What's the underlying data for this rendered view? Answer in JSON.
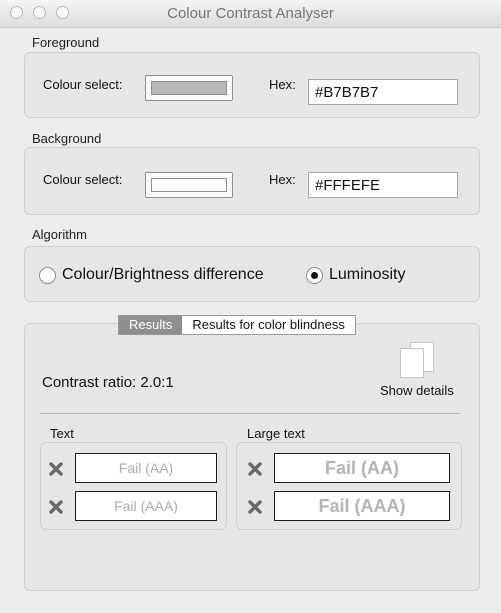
{
  "window": {
    "title": "Colour Contrast Analyser"
  },
  "foreground": {
    "section_label": "Foreground",
    "colour_select_label": "Colour select:",
    "hex_label": "Hex:",
    "hex_value": "#B7B7B7",
    "swatch_color": "#B7B7B7"
  },
  "background": {
    "section_label": "Background",
    "colour_select_label": "Colour select:",
    "hex_label": "Hex:",
    "hex_value": "#FFFEFE",
    "swatch_color": "#FFFEFE"
  },
  "algorithm": {
    "section_label": "Algorithm",
    "options": [
      {
        "label": "Colour/Brightness difference",
        "selected": false
      },
      {
        "label": "Luminosity",
        "selected": true
      }
    ]
  },
  "results": {
    "tabs": [
      {
        "label": "Results",
        "active": true
      },
      {
        "label": "Results for color blindness",
        "active": false
      }
    ],
    "contrast_ratio_text": "Contrast ratio: 2.0:1",
    "show_details_label": "Show details",
    "text_group": {
      "label": "Text",
      "rows": [
        {
          "value": "Fail (AA)"
        },
        {
          "value": "Fail (AAA)"
        }
      ]
    },
    "large_text_group": {
      "label": "Large text",
      "rows": [
        {
          "value": "Fail (AA)"
        },
        {
          "value": "Fail (AAA)"
        }
      ]
    }
  },
  "icons": {
    "fail": "x-mark-icon",
    "details": "documents-icon"
  },
  "colors": {
    "fail_mark": "#6a6a6a",
    "active_tab": "#8e8e8e"
  }
}
